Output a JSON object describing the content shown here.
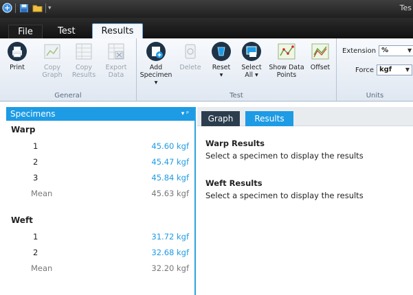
{
  "window": {
    "title": "Tes"
  },
  "ribbon_tabs": {
    "file": "File",
    "test": "Test",
    "results": "Results"
  },
  "groups": {
    "general": {
      "label": "General",
      "buttons": [
        {
          "line1": "Print",
          "line2": "",
          "icon": "printer-icon"
        },
        {
          "line1": "Copy",
          "line2": "Graph",
          "icon": "copy-graph-icon"
        },
        {
          "line1": "Copy",
          "line2": "Results",
          "icon": "copy-results-icon"
        },
        {
          "line1": "Export",
          "line2": "Data",
          "icon": "export-data-icon"
        }
      ]
    },
    "test": {
      "label": "Test",
      "buttons": [
        {
          "line1": "Add",
          "line2": "Specimen ▾",
          "icon": "add-specimen-icon"
        },
        {
          "line1": "Delete",
          "line2": "",
          "icon": "delete-icon"
        },
        {
          "line1": "Reset",
          "line2": "▾",
          "icon": "reset-icon"
        },
        {
          "line1": "Select",
          "line2": "All ▾",
          "icon": "select-all-icon"
        },
        {
          "line1": "Show Data",
          "line2": "Points",
          "icon": "show-data-points-icon"
        },
        {
          "line1": "Offset",
          "line2": "",
          "icon": "offset-icon"
        }
      ]
    },
    "units": {
      "label": "Units",
      "extension_label": "Extension",
      "extension_value": "%",
      "force_label": "Force",
      "force_value": "kgf"
    }
  },
  "specimens": {
    "title": "Specimens",
    "controls": "▾ ᵖ",
    "warp": {
      "title": "Warp",
      "rows": [
        {
          "n": "1",
          "value": "45.60 kgf"
        },
        {
          "n": "2",
          "value": "45.47 kgf"
        },
        {
          "n": "3",
          "value": "45.84 kgf"
        }
      ],
      "mean_label": "Mean",
      "mean_value": "45.63 kgf"
    },
    "weft": {
      "title": "Weft",
      "rows": [
        {
          "n": "1",
          "value": "31.72 kgf"
        },
        {
          "n": "2",
          "value": "32.68 kgf"
        }
      ],
      "mean_label": "Mean",
      "mean_value": "32.20 kgf"
    }
  },
  "results": {
    "tabs": {
      "graph": "Graph",
      "results": "Results"
    },
    "warp_title": "Warp Results",
    "warp_text": "Select a specimen to display the results",
    "weft_title": "Weft Results",
    "weft_text": "Select a specimen to display the results"
  },
  "colors": {
    "accent": "#1d9be5",
    "dark_tab": "#2c3e4e",
    "titlebar": "#2a2a2a"
  }
}
